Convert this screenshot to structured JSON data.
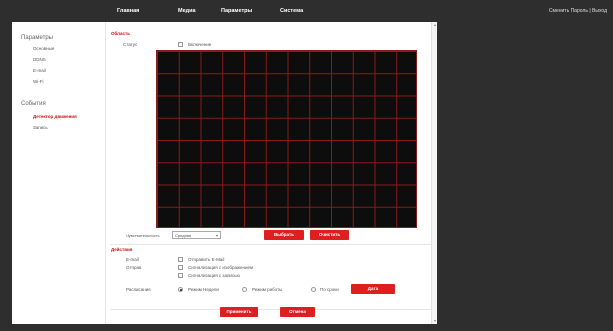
{
  "topnav": {
    "items": [
      "Главная",
      "Медиа",
      "Параметры",
      "Система"
    ]
  },
  "userlinks": {
    "change_password": "Сменить Пароль",
    "separator": "|",
    "exit": "Выход"
  },
  "sidebar": {
    "group1": {
      "header": "Параметры",
      "items": [
        "Основные",
        "DDNS",
        "E-mail",
        "Wi-Fi"
      ]
    },
    "group2": {
      "header": "События",
      "items": [
        "Детектор движения",
        "Запись"
      ]
    },
    "active_item": "Детектор движения"
  },
  "area": {
    "title": "Область",
    "status_label": "Статус",
    "enable_label": "Включение",
    "enabled": false,
    "sensitivity_label": "Чувствительность",
    "sensitivity_value": "Средняя",
    "select_button": "Выбрать",
    "clear_button": "Очистить"
  },
  "actions": {
    "title": "Действия",
    "email_label": "E-mail",
    "email_option": "Отправить E-Mail",
    "upload_label": "Отправ",
    "upload_option1": "Сигнализация с изображением",
    "upload_option2": "Сигнализация с записью",
    "schedule_label": "Расписание",
    "schedule_options": [
      "Режим Недели",
      "Режим работы",
      "По сроки"
    ],
    "schedule_selected": "Режим Недели",
    "edit_button": "Дата"
  },
  "footer": {
    "apply_button": "Применить",
    "refresh_button": "Отмена"
  },
  "colors": {
    "accent": "#dd1f1f",
    "grid_line": "#8b1a1a",
    "canvas_bg": "#0d0d0d",
    "page_bg": "#2e2e2e"
  }
}
